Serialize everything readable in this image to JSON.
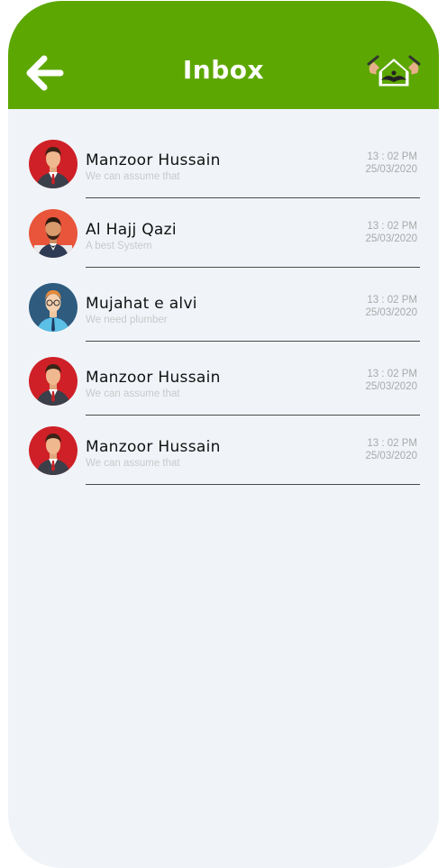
{
  "header": {
    "title": "Inbox",
    "back_icon": "arrow-left-icon",
    "logo_icon": "plumber-house-logo-icon",
    "background": "#5da703"
  },
  "messages": [
    {
      "name": "Manzoor Hussain",
      "preview": "We can assume that",
      "time": "13 : 02 PM",
      "date": "25/03/2020",
      "avatar": "man-in-suit-red-avatar"
    },
    {
      "name": "Al Hajj Qazi",
      "preview": "A best System",
      "time": "13 : 02 PM",
      "date": "25/03/2020",
      "avatar": "bearded-man-orange-avatar"
    },
    {
      "name": "Mujahat e alvi",
      "preview": "We need plumber",
      "time": "13 : 02 PM",
      "date": "25/03/2020",
      "avatar": "man-with-glasses-blue-avatar"
    },
    {
      "name": "Manzoor Hussain",
      "preview": "We can assume that",
      "time": "13 : 02 PM",
      "date": "25/03/2020",
      "avatar": "man-in-suit-red-avatar"
    },
    {
      "name": "Manzoor Hussain",
      "preview": "We can assume that",
      "time": "13 : 02 PM",
      "date": "25/03/2020",
      "avatar": "man-in-suit-red-avatar"
    }
  ]
}
